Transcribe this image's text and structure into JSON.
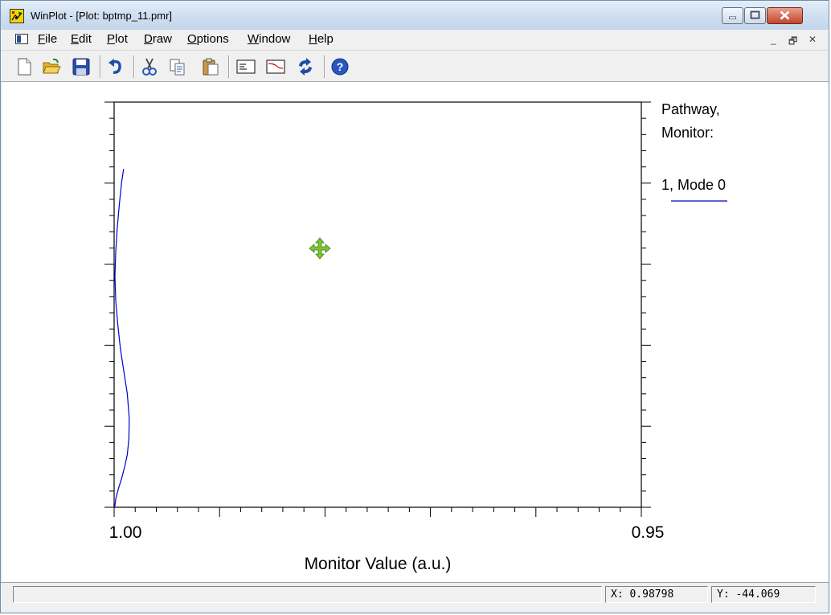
{
  "window": {
    "title": "WinPlot - [Plot: bptmp_11.pmr]",
    "icons": {
      "app": "winplot-app-icon",
      "minimize": "minimize-icon",
      "maximize": "maximize-icon",
      "close": "close-icon"
    }
  },
  "menu": {
    "items": [
      {
        "label": "File",
        "accel": "F"
      },
      {
        "label": "Edit",
        "accel": "E"
      },
      {
        "label": "Plot",
        "accel": "P"
      },
      {
        "label": "Draw",
        "accel": "D"
      },
      {
        "label": "Options",
        "accel": "O"
      },
      {
        "label": "Window",
        "accel": "W"
      },
      {
        "label": "Help",
        "accel": "H"
      }
    ],
    "mdi_controls": [
      "_",
      "🗗",
      "✕"
    ]
  },
  "toolbar": {
    "buttons": [
      {
        "name": "new-file-button",
        "icon": "new-file-icon"
      },
      {
        "name": "open-folder-button",
        "icon": "open-folder-icon"
      },
      {
        "name": "save-button",
        "icon": "save-icon"
      },
      {
        "name": "undo-button",
        "icon": "undo-icon"
      },
      {
        "name": "cut-button",
        "icon": "scissors-icon"
      },
      {
        "name": "copy-button",
        "icon": "copy-icon"
      },
      {
        "name": "paste-button",
        "icon": "paste-icon"
      },
      {
        "name": "properties-button",
        "icon": "properties-icon"
      },
      {
        "name": "plot-window-button",
        "icon": "plot-window-icon"
      },
      {
        "name": "refresh-button",
        "icon": "refresh-icon"
      },
      {
        "name": "help-button",
        "icon": "help-icon"
      }
    ]
  },
  "chart_data": {
    "type": "line",
    "xlabel": "Monitor Value (a.u.)",
    "x_tick_labels": [
      "1.00",
      "0.95"
    ],
    "xlim": [
      1.0,
      0.95
    ],
    "ylim": [
      -100,
      0
    ],
    "legend_title": [
      "Pathway,",
      "Monitor:"
    ],
    "legend_placement": "top-right",
    "series": [
      {
        "name": "1, Mode 0",
        "color": "#0000cc",
        "x": [
          0.9991,
          0.9993,
          0.9995,
          0.9997,
          0.99985,
          0.99992,
          0.99985,
          0.99965,
          0.9994,
          0.99905,
          0.99875,
          0.99857,
          0.9986,
          0.99875,
          0.999,
          0.9993,
          0.9996,
          0.99985,
          0.99995
        ],
        "y": [
          -16.5,
          -20,
          -25,
          -31,
          -37,
          -43,
          -49,
          -55,
          -61,
          -67,
          -72,
          -78,
          -83,
          -87,
          -90,
          -93,
          -95.5,
          -98,
          -100
        ]
      }
    ]
  },
  "cursor": {
    "icon": "move-cursor-icon",
    "color": "#7cc630"
  },
  "status": {
    "message": "",
    "x_readout": "X: 0.98798",
    "y_readout": "Y: -44.069"
  }
}
